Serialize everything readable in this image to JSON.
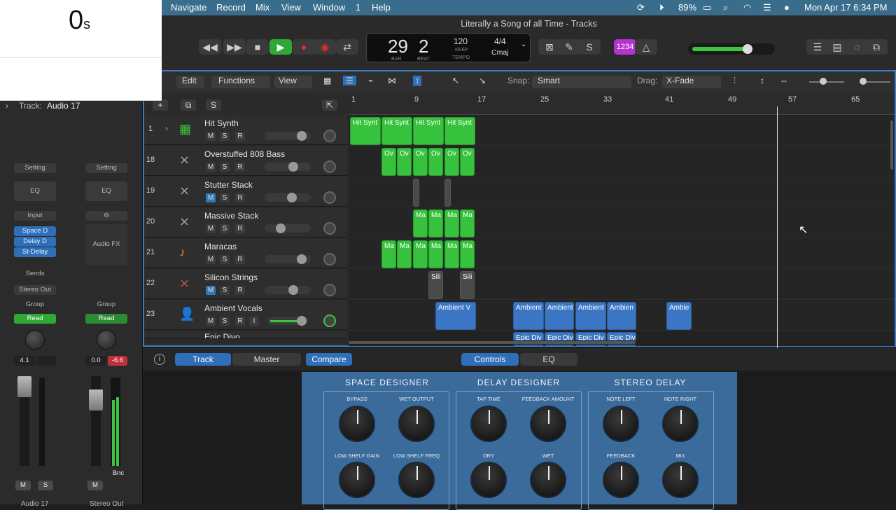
{
  "menubar": {
    "items": [
      "Navigate",
      "Record",
      "Mix",
      "View",
      "Window",
      "1",
      "Help"
    ],
    "battery": "89%",
    "datetime": "Mon Apr 17  6:34 PM"
  },
  "window": {
    "title": "Literally a Song of all Time - Tracks"
  },
  "lcd": {
    "bar": "29",
    "beat": "2",
    "bar_label": "BAR",
    "beat_label": "BEAT",
    "tempo": "120",
    "keep": "KEEP",
    "tempo_label": "TEMPO",
    "timesig": "4/4",
    "key": "Cmaj"
  },
  "counter": {
    "value": "0",
    "unit": "s"
  },
  "toolbar2": {
    "edit": "Edit",
    "functions": "Functions",
    "view": "View",
    "snap_label": "Snap:",
    "snap": "Smart",
    "drag_label": "Drag:",
    "drag": "X-Fade"
  },
  "inspector": {
    "track_label": "Track:",
    "track_name": "Audio 17",
    "setting": "Setting",
    "eq": "EQ",
    "input": "Input",
    "sends": "Sends",
    "stereo_out": "Stereo Out",
    "group": "Group",
    "read": "Read",
    "audio_fx": "Audio FX",
    "plugins": [
      "Space D",
      "Delay D",
      "St-Delay"
    ],
    "vol1": "4.1",
    "vol2": "0.0",
    "peak2": "-6.6",
    "m": "M",
    "s": "S",
    "bnc": "Bnc",
    "ch1": "Audio 17",
    "ch2": "Stereo Out"
  },
  "tracks": [
    {
      "num": "1",
      "name": "Hit Synth"
    },
    {
      "num": "18",
      "name": "Overstuffed 808 Bass"
    },
    {
      "num": "19",
      "name": "Stutter Stack"
    },
    {
      "num": "20",
      "name": "Massive Stack"
    },
    {
      "num": "21",
      "name": "Maracas"
    },
    {
      "num": "22",
      "name": "Silicon Strings"
    },
    {
      "num": "23",
      "name": "Ambient Vocals"
    },
    {
      "num": "",
      "name": "Epic Divo"
    }
  ],
  "ruler": [
    "1",
    "9",
    "17",
    "25",
    "33",
    "41",
    "49",
    "57",
    "65"
  ],
  "regions": {
    "hit": "Hit Synt",
    "ov": "Ov",
    "ma": "Ma",
    "sili": "Sili",
    "amb1": "Ambient V",
    "amb": "Ambient",
    "ambie": "Ambien",
    "ambi": "Ambie",
    "epic": "Epic Div"
  },
  "bottom": {
    "track_tab": "Track",
    "master": "Master",
    "compare": "Compare",
    "controls": "Controls",
    "eq": "EQ"
  },
  "plugin": {
    "sections": [
      {
        "title": "SPACE DESIGNER",
        "params": [
          "BYPASS",
          "WET OUTPUT",
          "LOW SHELF GAIN",
          "LOW SHELF FREQ"
        ]
      },
      {
        "title": "DELAY DESIGNER",
        "params": [
          "TAP TIME",
          "FEEDBACK AMOUNT",
          "DRY",
          "WET"
        ]
      },
      {
        "title": "STEREO DELAY",
        "params": [
          "NOTE LEFT",
          "NOTE RIGHT",
          "FEEDBACK",
          "MIX"
        ]
      }
    ]
  }
}
